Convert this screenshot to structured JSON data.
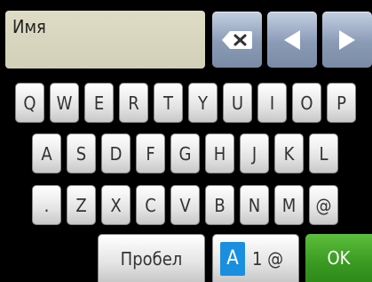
{
  "input": {
    "value": "Имя"
  },
  "icons": {
    "backspace": "backspace-icon",
    "left": "arrow-left-icon",
    "right": "arrow-right-icon"
  },
  "keyboard": {
    "row1": [
      "Q",
      "W",
      "E",
      "R",
      "T",
      "Y",
      "U",
      "I",
      "O",
      "P"
    ],
    "row2": [
      "A",
      "S",
      "D",
      "F",
      "G",
      "H",
      "J",
      "K",
      "L"
    ],
    "row3": [
      ".",
      "Z",
      "X",
      "C",
      "V",
      "B",
      "N",
      "M",
      "@"
    ]
  },
  "bottom": {
    "space_label": "Пробел",
    "mode_active": "A",
    "mode_rest": "1 @",
    "ok_label": "OK"
  },
  "colors": {
    "ok": "#3a9a22",
    "mode_active": "#1a8fe0",
    "field": "#d8d6be"
  }
}
